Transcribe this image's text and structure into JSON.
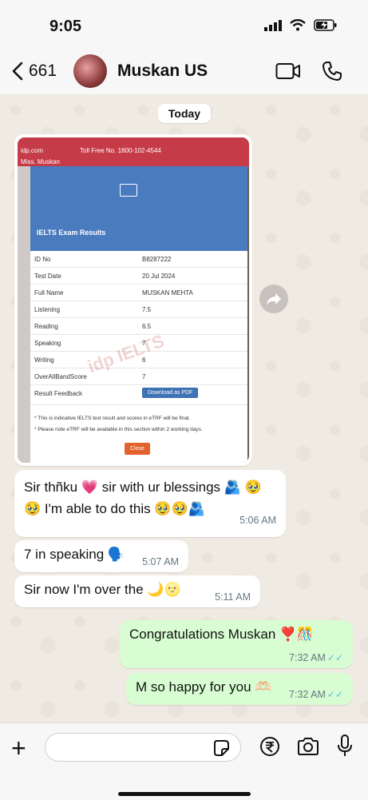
{
  "status_bar": {
    "time": "9:05"
  },
  "header": {
    "back_count": "661",
    "contact_name": "Muskan US"
  },
  "chat": {
    "day_chip": "Today",
    "image_message": {
      "time": "5:06 AM",
      "screenshot": {
        "top_email": "idp.com",
        "top_phone": "Toll Free No. 1800-102-4544",
        "top_name": "Miss. Muskan",
        "logo_fragment": "idp",
        "title": "IELTS Exam Results",
        "rows": [
          {
            "label": "ID No",
            "value": "B8287222"
          },
          {
            "label": "Test Date",
            "value": "20 Jul 2024"
          },
          {
            "label": "Full Name",
            "value": "MUSKAN MEHTA"
          },
          {
            "label": "Listening",
            "value": "7.5"
          },
          {
            "label": "Reading",
            "value": "6.5"
          },
          {
            "label": "Speaking",
            "value": "7"
          },
          {
            "label": "Writing",
            "value": "6"
          },
          {
            "label": "OverAllBandScore",
            "value": "7"
          }
        ],
        "feedback_label": "Result Feedback",
        "download_button": "Download as PDF",
        "note1": "* This is indicative IELTS test result and scores in eTRF will be final.",
        "note2": "* Please note eTRF will be available in this section within 2 working days.",
        "close_button": "Close",
        "watermark": "idp IELTS"
      }
    },
    "messages": [
      {
        "direction": "in",
        "text": "Sir thñku 💗 sir with ur blessings 🫂 🥹🥹 I'm able to do this 🥹🥹🫂",
        "time": "5:06 AM"
      },
      {
        "direction": "in",
        "text": "7 in speaking 🗣️",
        "time": "5:07 AM"
      },
      {
        "direction": "in",
        "text": "Sir now I'm over the 🌙🌝",
        "time": "5:11 AM"
      },
      {
        "direction": "out",
        "text": "Congratulations Muskan ❣️🎊",
        "time": "7:32 AM",
        "ticks": "✓✓"
      },
      {
        "direction": "out",
        "text": "M so happy for you 🫶🏻",
        "time": "7:32 AM",
        "ticks": "✓✓"
      }
    ]
  },
  "input": {
    "placeholder": ""
  },
  "colors": {
    "accent_blue": "#53bdeb",
    "outgoing_bg": "#d9fdd3",
    "chat_bg": "#efeae2"
  }
}
